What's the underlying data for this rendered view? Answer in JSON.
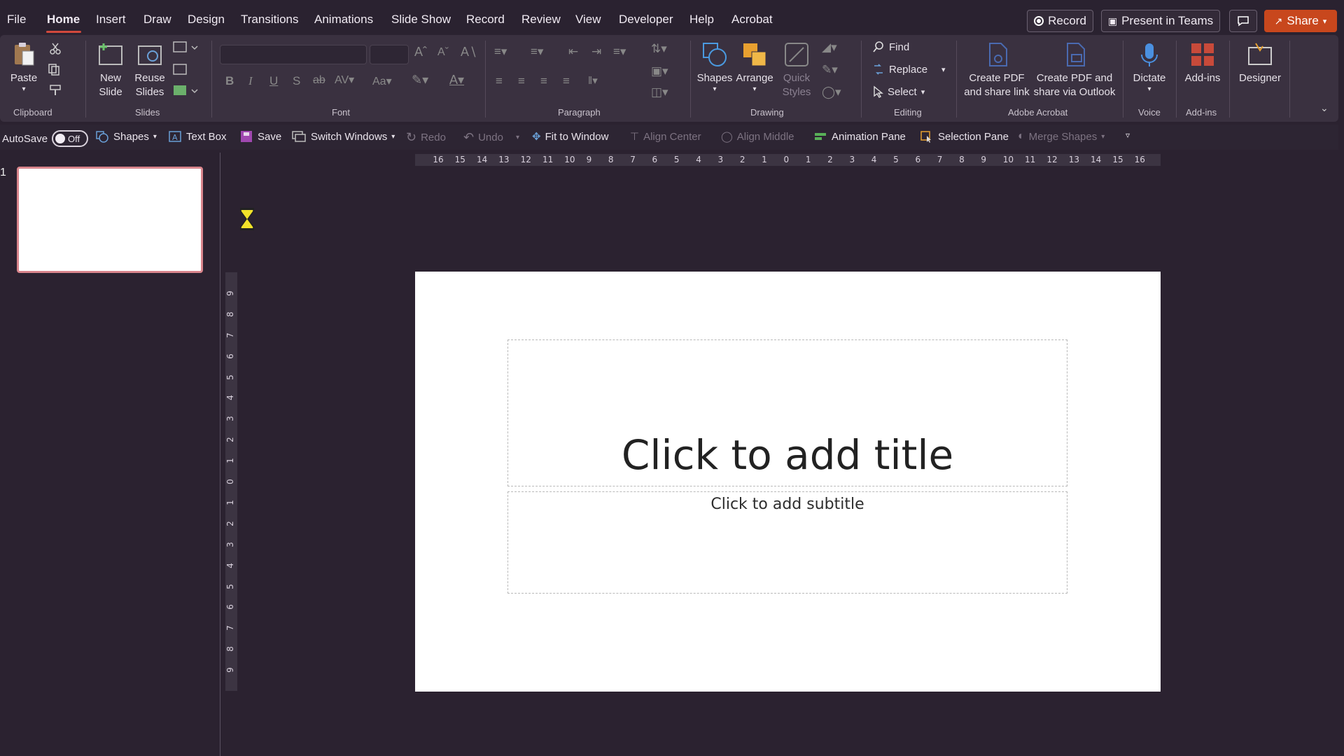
{
  "menu": {
    "items": [
      "File",
      "Home",
      "Insert",
      "Draw",
      "Design",
      "Transitions",
      "Animations",
      "Slide Show",
      "Record",
      "Review",
      "View",
      "Developer",
      "Help",
      "Acrobat"
    ],
    "active": "Home"
  },
  "top_buttons": {
    "record": "Record",
    "present": "Present in Teams",
    "share": "Share"
  },
  "ribbon": {
    "clipboard": {
      "paste": "Paste",
      "label": "Clipboard"
    },
    "slides": {
      "new_slide_1": "New",
      "new_slide_2": "Slide",
      "reuse_1": "Reuse",
      "reuse_2": "Slides",
      "label": "Slides"
    },
    "font": {
      "label": "Font",
      "font_name": "",
      "font_size": ""
    },
    "paragraph": {
      "label": "Paragraph"
    },
    "drawing": {
      "shapes": "Shapes",
      "arrange": "Arrange",
      "quick_styles_1": "Quick",
      "quick_styles_2": "Styles",
      "label": "Drawing"
    },
    "editing": {
      "find": "Find",
      "replace": "Replace",
      "select": "Select",
      "label": "Editing"
    },
    "acrobat": {
      "create_pdf_1": "Create PDF",
      "create_pdf_2": "and share link",
      "create_outlook_1": "Create PDF and",
      "create_outlook_2": "share via Outlook",
      "label": "Adobe Acrobat"
    },
    "voice": {
      "dictate": "Dictate",
      "label": "Voice"
    },
    "addins": {
      "addins": "Add-ins",
      "label": "Add-ins"
    },
    "designer": {
      "designer": "Designer"
    }
  },
  "qat": {
    "autosave": "AutoSave",
    "autosave_state": "Off",
    "shapes": "Shapes",
    "text_box": "Text Box",
    "save": "Save",
    "switch_windows": "Switch Windows",
    "redo": "Redo",
    "undo": "Undo",
    "fit_to_window": "Fit to Window",
    "align_center": "Align Center",
    "align_middle": "Align Middle",
    "animation_pane": "Animation Pane",
    "selection_pane": "Selection Pane",
    "merge_shapes": "Merge Shapes"
  },
  "thumbnails": {
    "slide_number": "1"
  },
  "slide": {
    "title_placeholder": "Click to add title",
    "subtitle_placeholder": "Click to add subtitle"
  },
  "rulers": {
    "horizontal": [
      "16",
      "15",
      "14",
      "13",
      "12",
      "11",
      "10",
      "9",
      "8",
      "7",
      "6",
      "5",
      "4",
      "3",
      "2",
      "1",
      "0",
      "1",
      "2",
      "3",
      "4",
      "5",
      "6",
      "7",
      "8",
      "9",
      "10",
      "11",
      "12",
      "13",
      "14",
      "15",
      "16"
    ],
    "vertical": [
      "9",
      "8",
      "7",
      "6",
      "5",
      "4",
      "3",
      "2",
      "1",
      "0",
      "1",
      "2",
      "3",
      "4",
      "5",
      "6",
      "7",
      "8",
      "9"
    ]
  },
  "colors": {
    "accent": "#d2493c",
    "share": "#c8471d",
    "ribbon_bg": "#3a3140",
    "app_bg": "#2b2230"
  }
}
